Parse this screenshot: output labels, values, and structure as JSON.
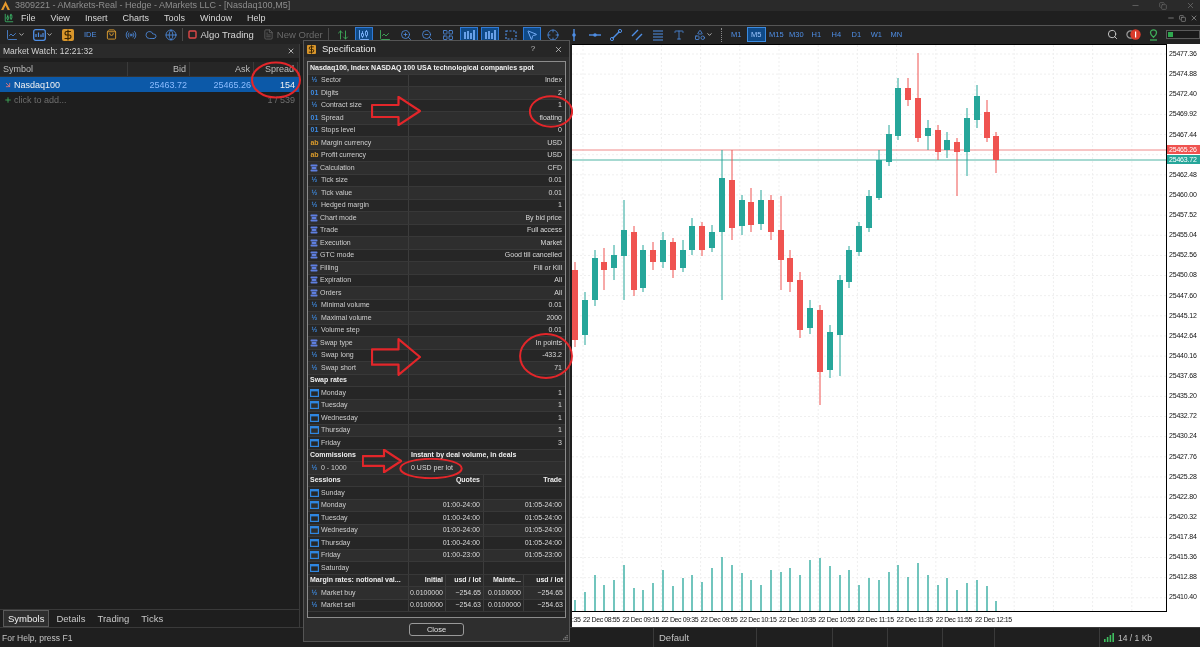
{
  "window": {
    "title": "3809221 - AMarkets-Real - Hedge - AMarkets LLC - [Nasdaq100,M5]"
  },
  "menu": [
    "File",
    "View",
    "Insert",
    "Charts",
    "Tools",
    "Window",
    "Help"
  ],
  "toolbar": {
    "ide": "IDE",
    "algo_trading": {
      "label": "Algo Trading",
      "on": false
    },
    "new_order": {
      "label": "New Order",
      "disabled": true
    },
    "tools": [
      {
        "kind": "oneclick",
        "selected": false
      },
      {
        "kind": "candles",
        "selected": true
      },
      {
        "kind": "line",
        "selected": false
      },
      {
        "kind": "zoomin",
        "selected": false
      },
      {
        "kind": "zoomout",
        "selected": false
      },
      {
        "kind": "tile",
        "selected": false
      },
      {
        "kind": "autoscroll",
        "selected": true
      },
      {
        "kind": "shift",
        "selected": true
      },
      {
        "kind": "period",
        "selected": false
      },
      {
        "kind": "cursor",
        "selected": true
      },
      {
        "kind": "crosshair",
        "selected": false
      },
      {
        "kind": "vline",
        "selected": false
      },
      {
        "kind": "hline",
        "selected": false
      },
      {
        "kind": "trendline",
        "selected": false
      },
      {
        "kind": "channel",
        "selected": false
      },
      {
        "kind": "fibo",
        "selected": false
      },
      {
        "kind": "text",
        "selected": false
      },
      {
        "kind": "shapes",
        "selected": false
      }
    ],
    "timeframes": [
      {
        "label": "M1",
        "selected": false
      },
      {
        "label": "M5",
        "selected": true
      },
      {
        "label": "M15",
        "selected": false
      },
      {
        "label": "M30",
        "selected": false
      },
      {
        "label": "H1",
        "selected": false
      },
      {
        "label": "H4",
        "selected": false
      },
      {
        "label": "D1",
        "selected": false
      },
      {
        "label": "W1",
        "selected": false
      },
      {
        "label": "MN",
        "selected": false
      }
    ],
    "connection": {
      "level": 0.15
    }
  },
  "market_watch": {
    "title": "Market Watch: 12:21:32",
    "columns": [
      "Symbol",
      "Bid",
      "Ask",
      "Spread"
    ],
    "rows": [
      {
        "symbol": "Nasdaq100",
        "bid": "25463.72",
        "ask": "25465.26",
        "spread": "154",
        "falling": true,
        "selected": true
      }
    ],
    "add_row": {
      "label": "click to add...",
      "count": "1 / 539"
    },
    "tabs": [
      {
        "label": "Symbols",
        "selected": true
      },
      {
        "label": "Details",
        "selected": false
      },
      {
        "label": "Trading",
        "selected": false
      },
      {
        "label": "Ticks",
        "selected": false
      }
    ]
  },
  "specification": {
    "title": "Specification",
    "help": "?",
    "heading": "Nasdaq100, Index NASDAQ 100 USA technological companies spot",
    "properties": [
      {
        "label": "Sector",
        "value": "Index",
        "kind": "fraction",
        "icon": "½"
      },
      {
        "label": "Digits",
        "value": "2",
        "kind": "digits",
        "icon": "01"
      },
      {
        "label": "Contract size",
        "value": "1",
        "kind": "fraction",
        "icon": "½"
      },
      {
        "label": "Spread",
        "value": "floating",
        "kind": "digits",
        "icon": "01"
      },
      {
        "label": "Stops level",
        "value": "0",
        "kind": "digits",
        "icon": "01"
      },
      {
        "label": "Margin currency",
        "value": "USD",
        "kind": "letters",
        "icon": "ab"
      },
      {
        "label": "Profit currency",
        "value": "USD",
        "kind": "letters",
        "icon": "ab"
      },
      {
        "label": "Calculation",
        "value": "CFD",
        "kind": "list"
      },
      {
        "label": "Tick size",
        "value": "0.01",
        "kind": "fraction",
        "icon": "½"
      },
      {
        "label": "Tick value",
        "value": "0.01",
        "kind": "fraction",
        "icon": "½"
      },
      {
        "label": "Hedged margin",
        "value": "1",
        "kind": "fraction",
        "icon": "½"
      },
      {
        "label": "Chart mode",
        "value": "By bid price",
        "kind": "list"
      },
      {
        "label": "Trade",
        "value": "Full access",
        "kind": "list"
      },
      {
        "label": "Execution",
        "value": "Market",
        "kind": "list"
      },
      {
        "label": "GTC mode",
        "value": "Good till cancelled",
        "kind": "list"
      },
      {
        "label": "Filling",
        "value": "Fill or Kill",
        "kind": "list"
      },
      {
        "label": "Expiration",
        "value": "All",
        "kind": "list"
      },
      {
        "label": "Orders",
        "value": "All",
        "kind": "list"
      },
      {
        "label": "Minimal volume",
        "value": "0.01",
        "kind": "fraction",
        "icon": "½"
      },
      {
        "label": "Maximal volume",
        "value": "2000",
        "kind": "fraction",
        "icon": "½"
      },
      {
        "label": "Volume step",
        "value": "0.01",
        "kind": "fraction",
        "icon": "½"
      },
      {
        "label": "Swap type",
        "value": "In points",
        "kind": "list"
      },
      {
        "label": "Swap long",
        "value": "-433.2",
        "kind": "fraction",
        "icon": "½"
      },
      {
        "label": "Swap short",
        "value": "71",
        "kind": "fraction",
        "icon": "½"
      }
    ],
    "swap_rates": {
      "title": "Swap rates",
      "days": [
        {
          "label": "Monday",
          "value": "1"
        },
        {
          "label": "Tuesday",
          "value": "1"
        },
        {
          "label": "Wednesday",
          "value": "1"
        },
        {
          "label": "Thursday",
          "value": "1"
        },
        {
          "label": "Friday",
          "value": "3"
        }
      ]
    },
    "commissions": {
      "title": "Commissions",
      "mode": "Instant by deal volume, in deals",
      "tiers": [
        {
          "range": "0 - 1000",
          "value": "0 USD per lot",
          "icon": "½"
        }
      ]
    },
    "sessions": {
      "title": "Sessions",
      "columns": [
        "Quotes",
        "Trade"
      ],
      "days": [
        {
          "label": "Sunday"
        },
        {
          "label": "Monday",
          "quotes": "01:00-24:00",
          "trade": "01:05-24:00"
        },
        {
          "label": "Tuesday",
          "quotes": "01:00-24:00",
          "trade": "01:05-24:00"
        },
        {
          "label": "Wednesday",
          "quotes": "01:00-24:00",
          "trade": "01:05-24:00"
        },
        {
          "label": "Thursday",
          "quotes": "01:00-24:00",
          "trade": "01:05-24:00"
        },
        {
          "label": "Friday",
          "quotes": "01:00-23:00",
          "trade": "01:05-23:00"
        },
        {
          "label": "Saturday"
        }
      ]
    },
    "margin_rates": {
      "title": "Margin rates: notional val...",
      "columns": [
        "Initial",
        "usd / lot",
        "Mainte...",
        "usd / lot"
      ],
      "rows": [
        {
          "label": "Market buy",
          "icon": "½",
          "values": [
            "0.0100000",
            "~254.65",
            "0.0100000",
            "~254.65"
          ]
        },
        {
          "label": "Market sell",
          "icon": "½",
          "values": [
            "0.0100000",
            "~254.63",
            "0.0100000",
            "~254.63"
          ]
        }
      ]
    },
    "close_button": "Close"
  },
  "chart": {
    "price_axis": [
      {
        "kind": "tick",
        "label": "25477.36"
      },
      {
        "kind": "tick",
        "label": "25474.88"
      },
      {
        "kind": "tick",
        "label": "25472.40"
      },
      {
        "kind": "tick",
        "label": "25469.92"
      },
      {
        "kind": "tick",
        "label": "25467.44"
      },
      {
        "kind": "tag",
        "label": "25465.26",
        "color": "#ef5350"
      },
      {
        "kind": "tag",
        "label": "25463.72",
        "color": "#26a69a"
      },
      {
        "kind": "tick",
        "label": "25462.48"
      },
      {
        "kind": "tick",
        "label": "25460.00"
      },
      {
        "kind": "tick",
        "label": "25457.52"
      },
      {
        "kind": "tick",
        "label": "25455.04"
      },
      {
        "kind": "tick",
        "label": "25452.56"
      },
      {
        "kind": "tick",
        "label": "25450.08"
      },
      {
        "kind": "tick",
        "label": "25447.60"
      },
      {
        "kind": "tick",
        "label": "25445.12"
      },
      {
        "kind": "tick",
        "label": "25442.64"
      },
      {
        "kind": "tick",
        "label": "25440.16"
      },
      {
        "kind": "tick",
        "label": "25437.68"
      },
      {
        "kind": "tick",
        "label": "25435.20"
      },
      {
        "kind": "tick",
        "label": "25432.72"
      },
      {
        "kind": "tick",
        "label": "25430.24"
      },
      {
        "kind": "tick",
        "label": "25427.76"
      },
      {
        "kind": "tick",
        "label": "25425.28"
      },
      {
        "kind": "tick",
        "label": "25422.80"
      },
      {
        "kind": "tick",
        "label": "25420.32"
      },
      {
        "kind": "tick",
        "label": "25417.84"
      },
      {
        "kind": "tick",
        "label": "25415.36"
      },
      {
        "kind": "tick",
        "label": "25412.88"
      },
      {
        "kind": "tick",
        "label": "25410.40"
      }
    ],
    "time_axis": [
      ":35",
      "22 Dec 08:55",
      "22 Dec 09:15",
      "22 Dec 09:35",
      "22 Dec 09:55",
      "22 Dec 10:15",
      "22 Dec 10:35",
      "22 Dec 10:55",
      "22 Dec 11:15",
      "22 Dec 11:35",
      "22 Dec 11:55",
      "22 Dec 12:15"
    ]
  },
  "status_bar": {
    "help": "For Help, press F1",
    "profile": "Default",
    "traffic": "14 / 1 Kb"
  }
}
